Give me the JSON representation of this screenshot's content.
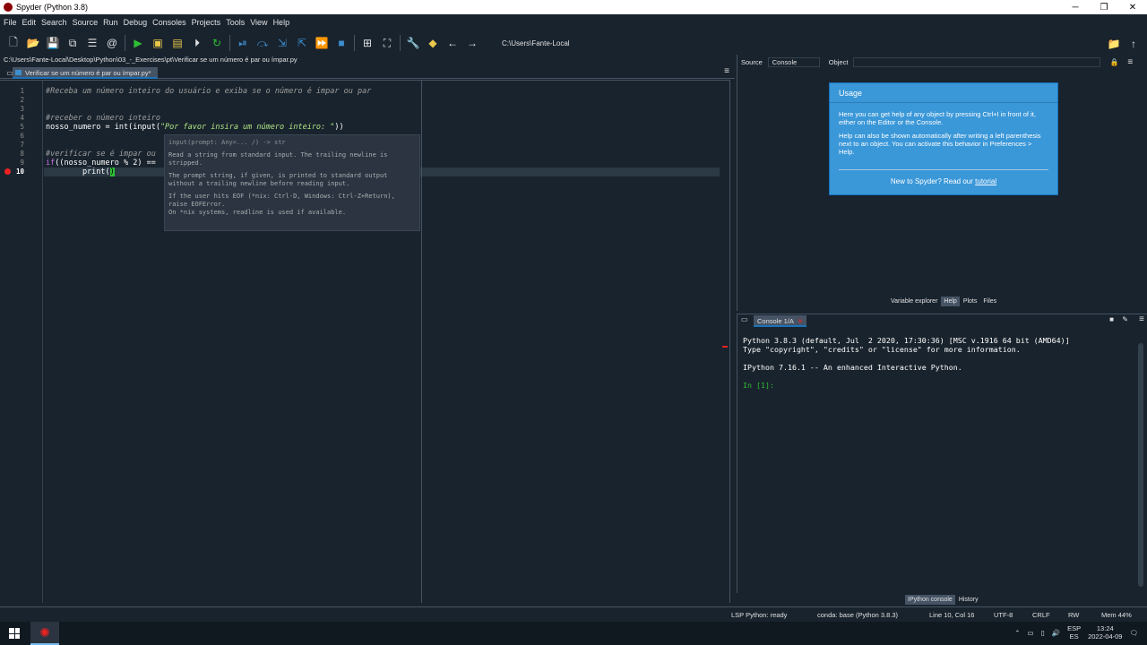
{
  "window": {
    "title": "Spyder (Python 3.8)",
    "minimize": "─",
    "maximize": "❐",
    "close": "✕"
  },
  "menu": [
    "File",
    "Edit",
    "Search",
    "Source",
    "Run",
    "Debug",
    "Consoles",
    "Projects",
    "Tools",
    "View",
    "Help"
  ],
  "toolbar": {
    "working_dir": "C:\\Users\\Fante-Local"
  },
  "editor": {
    "file_path": "C:\\Users\\Fante-Local\\Desktop\\Python\\03_-_Exercises\\pt\\Verificar se um número é par ou ímpar.py",
    "tab_label": "Verificar se um número é par ou ímpar.py*",
    "line_numbers": [
      "1",
      "2",
      "3",
      "4",
      "5",
      "6",
      "7",
      "8",
      "9",
      "10"
    ],
    "lines": {
      "l1": "#Receba um número inteiro do usuário e exiba se o número é impar ou par",
      "l4": "#receber o número inteiro",
      "l5_pre": "nosso_numero = int(input(",
      "l5_str": "\"Por favor insira um número inteiro: \"",
      "l5_post": "))",
      "l8": "#verificar se é impar ou",
      "l9_kw": "if",
      "l9": "((nosso_numero % 2) ==",
      "l10_pre": "        print(",
      "l10_cur": ")"
    },
    "calltip": {
      "signature": "input(prompt: Any=...  /) -> str",
      "p1": "Read a string from standard input. The trailing newline is stripped.",
      "p2": "The prompt string, if given, is printed to standard output without a trailing newline before reading input.",
      "p3": "If the user hits EOF (*nix: Ctrl-D, Windows: Ctrl-Z+Return), raise EOFError.\nOn *nix systems, readline is used if available."
    }
  },
  "help_pane": {
    "source_label": "Source",
    "source_value": "Console",
    "object_label": "Object",
    "usage_title": "Usage",
    "usage_p1": "Here you can get help of any object by pressing Ctrl+I in front of it, either on the Editor or the Console.",
    "usage_p2": "Help can also be shown automatically after writing a left parenthesis next to an object. You can activate this behavior in Preferences > Help.",
    "usage_foot": "New to Spyder? Read our",
    "usage_link": "tutorial",
    "tabs": [
      "Variable explorer",
      "Help",
      "Plots",
      "Files"
    ]
  },
  "console": {
    "tab_label": "Console 1/A",
    "line1": "Python 3.8.3 (default, Jul  2 2020, 17:30:36) [MSC v.1916 64 bit (AMD64)]",
    "line2": "Type \"copyright\", \"credits\" or \"license\" for more information.",
    "line3": "IPython 7.16.1 -- An enhanced Interactive Python.",
    "prompt": "In [1]:",
    "bottom_tabs": [
      "IPython console",
      "History"
    ]
  },
  "status": {
    "lsp": "LSP Python: ready",
    "conda": "conda: base (Python 3.8.3)",
    "position": "Line 10, Col 16",
    "encoding": "UTF-8",
    "eol": "CRLF",
    "rw": "RW",
    "mem": "Mem 44%"
  },
  "taskbar": {
    "lang1": "ESP",
    "lang2": "ES",
    "time": "13:24",
    "date": "2022-04-09"
  }
}
